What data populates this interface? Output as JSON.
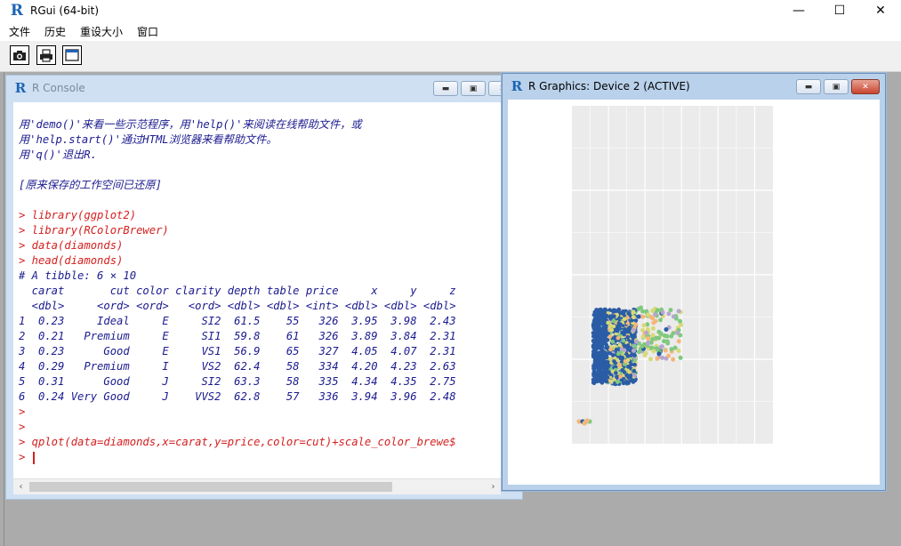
{
  "app": {
    "title": "RGui (64-bit)",
    "icon": "r-logo-icon",
    "controls": {
      "minimize": "—",
      "maximize": "☐",
      "close": "✕"
    }
  },
  "menu": [
    "文件",
    "历史",
    "重设大小",
    "窗口"
  ],
  "toolbar": [
    {
      "name": "copy-screenshot-button",
      "icon": "camera-icon"
    },
    {
      "name": "print-button",
      "icon": "printer-icon"
    },
    {
      "name": "console-window-button",
      "icon": "window-icon"
    }
  ],
  "console": {
    "title": "R Console",
    "lines": [
      {
        "kind": "blank",
        "text": ""
      },
      {
        "kind": "msg",
        "text": "用'demo()'来看一些示范程序，用'help()'来阅读在线帮助文件，或"
      },
      {
        "kind": "msg",
        "text": "用'help.start()'通过HTML浏览器来看帮助文件。"
      },
      {
        "kind": "msg",
        "text": "用'q()'退出R."
      },
      {
        "kind": "blank",
        "text": ""
      },
      {
        "kind": "msg",
        "text": "[原来保存的工作空间已还原]"
      },
      {
        "kind": "blank",
        "text": ""
      },
      {
        "kind": "cmd",
        "text": "> library(ggplot2)"
      },
      {
        "kind": "cmd",
        "text": "> library(RColorBrewer)"
      },
      {
        "kind": "cmd",
        "text": "> data(diamonds)"
      },
      {
        "kind": "cmd",
        "text": "> head(diamonds)"
      },
      {
        "kind": "out",
        "text": "# A tibble: 6 × 10"
      },
      {
        "kind": "out",
        "text": "  carat       cut color clarity depth table price     x     y     z"
      },
      {
        "kind": "out",
        "text": "  <dbl>     <ord> <ord>   <ord> <dbl> <dbl> <int> <dbl> <dbl> <dbl>"
      },
      {
        "kind": "out",
        "text": "1  0.23     Ideal     E     SI2  61.5    55   326  3.95  3.98  2.43"
      },
      {
        "kind": "out",
        "text": "2  0.21   Premium     E     SI1  59.8    61   326  3.89  3.84  2.31"
      },
      {
        "kind": "out",
        "text": "3  0.23      Good     E     VS1  56.9    65   327  4.05  4.07  2.31"
      },
      {
        "kind": "out",
        "text": "4  0.29   Premium     I     VS2  62.4    58   334  4.20  4.23  2.63"
      },
      {
        "kind": "out",
        "text": "5  0.31      Good     J     SI2  63.3    58   335  4.34  4.35  2.75"
      },
      {
        "kind": "out",
        "text": "6  0.24 Very Good     J    VVS2  62.8    57   336  3.94  3.96  2.48"
      },
      {
        "kind": "cmd",
        "text": ">"
      },
      {
        "kind": "cmd",
        "text": ">"
      },
      {
        "kind": "cmd",
        "text": "> qplot(data=diamonds,x=carat,y=price,color=cut)+scale_color_brewe$"
      },
      {
        "kind": "prompt",
        "text": "> "
      }
    ],
    "scroll": {
      "left": "‹",
      "right": "›"
    }
  },
  "graphics": {
    "title": "R Graphics: Device 2 (ACTIVE)",
    "chart_data": {
      "type": "scatter",
      "grid": true,
      "background": "#ebebeb",
      "gridColor": "#ffffff",
      "palette": [
        "#2b5da6",
        "#d9d978",
        "#7fc97f",
        "#f5b67a",
        "#b5a7cc"
      ],
      "note": "points clustered in two groups, no axis text rendered"
    }
  },
  "colors": {
    "cmd": "#d42020",
    "out": "#1b1b8f",
    "activeTitle": "#b9d1ea"
  }
}
